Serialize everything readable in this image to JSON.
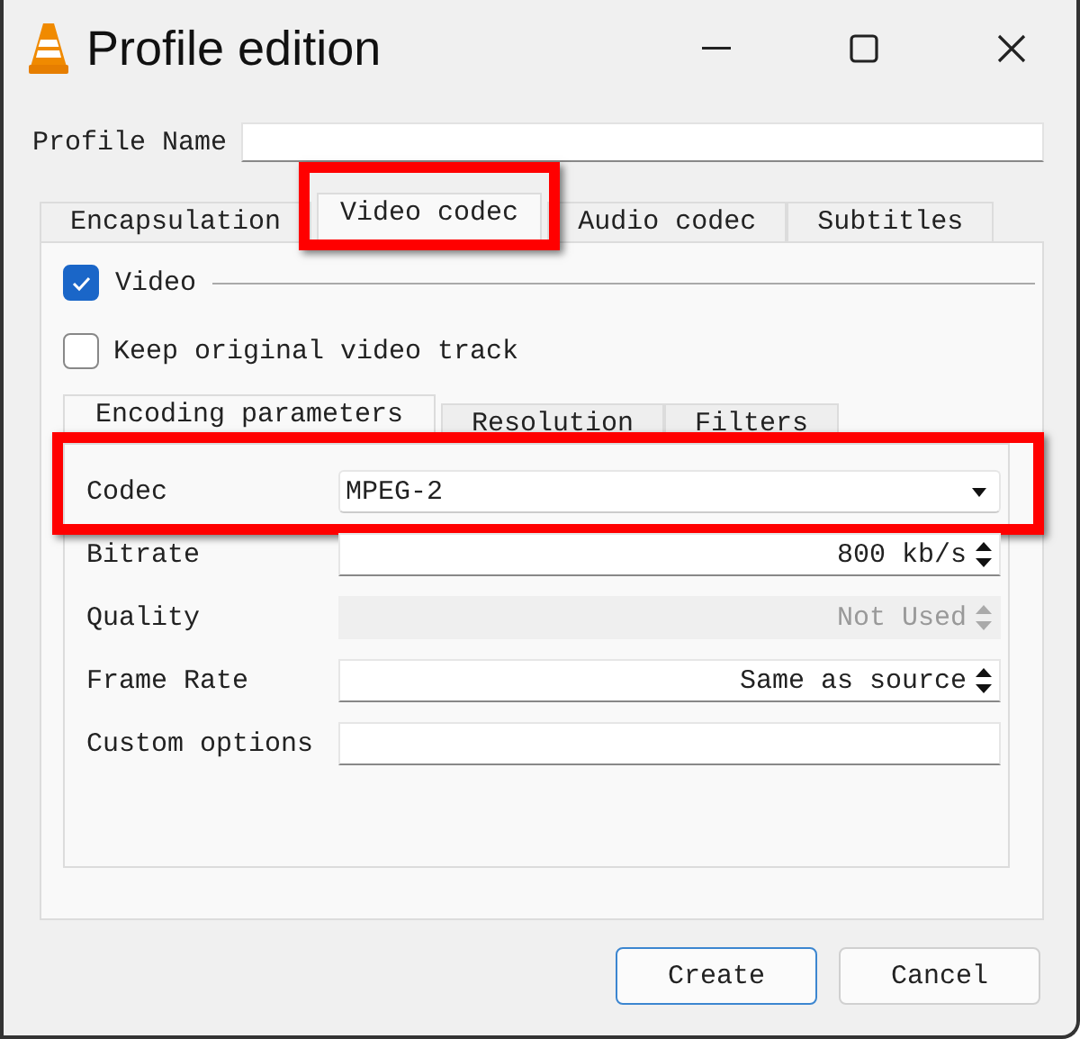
{
  "window": {
    "title": "Profile edition"
  },
  "profile_name": {
    "label": "Profile Name"
  },
  "tabs": [
    {
      "label": "Encapsulation",
      "selected": false,
      "highlighted": false
    },
    {
      "label": "Video codec",
      "selected": true,
      "highlighted": true
    },
    {
      "label": "Audio codec",
      "selected": false,
      "highlighted": false
    },
    {
      "label": "Subtitles",
      "selected": false,
      "highlighted": false
    }
  ],
  "video": {
    "label": "Video",
    "checked": true
  },
  "keep_original": {
    "label": "Keep original video track",
    "checked": false
  },
  "subtabs": [
    {
      "label": "Encoding parameters",
      "selected": true
    },
    {
      "label": "Resolution",
      "selected": false
    },
    {
      "label": "Filters",
      "selected": false
    }
  ],
  "params": [
    {
      "kind": "dropdown",
      "label": "Codec",
      "value": "MPEG-2",
      "disabled": false,
      "highlighted": true
    },
    {
      "kind": "spin",
      "label": "Bitrate",
      "value": "800 kb/s",
      "disabled": false,
      "highlighted": false
    },
    {
      "kind": "spin",
      "label": "Quality",
      "value": "Not Used",
      "disabled": true,
      "highlighted": false
    },
    {
      "kind": "spin",
      "label": "Frame Rate",
      "value": "Same as source",
      "disabled": false,
      "highlighted": false
    },
    {
      "kind": "text",
      "label": "Custom options",
      "disabled": false,
      "highlighted": false
    }
  ],
  "buttons": [
    {
      "label": "Create",
      "default": true
    },
    {
      "label": "Cancel",
      "default": false
    }
  ]
}
